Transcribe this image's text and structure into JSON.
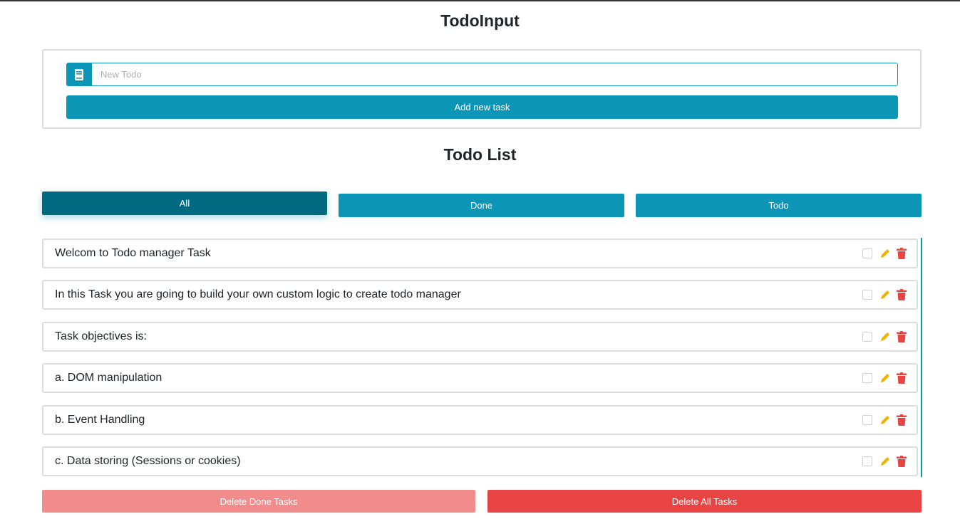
{
  "header": {
    "title": "TodoInput"
  },
  "input": {
    "placeholder": "New Todo",
    "value": "",
    "icon": "book-icon",
    "add_label": "Add new task"
  },
  "list": {
    "title": "Todo List",
    "filters": [
      {
        "label": "All",
        "active": true
      },
      {
        "label": "Done",
        "active": false
      },
      {
        "label": "Todo",
        "active": false
      }
    ],
    "items": [
      {
        "text": "Welcom to Todo manager Task",
        "done": false
      },
      {
        "text": "In this Task you are going to build your own custom logic to create todo manager",
        "done": false
      },
      {
        "text": "Task objectives is:",
        "done": false
      },
      {
        "text": "a. DOM manipulation",
        "done": false
      },
      {
        "text": "b. Event Handling",
        "done": false
      },
      {
        "text": "c. Data storing (Sessions or cookies)",
        "done": false
      }
    ]
  },
  "footer": {
    "delete_done_label": "Delete Done Tasks",
    "delete_all_label": "Delete All Tasks"
  },
  "colors": {
    "primary": "#0b96b8",
    "primary_active": "#026a80",
    "danger": "#e84444",
    "danger_light": "#f28b8b",
    "edit_icon": "#f0b400",
    "delete_icon": "#e84444"
  }
}
